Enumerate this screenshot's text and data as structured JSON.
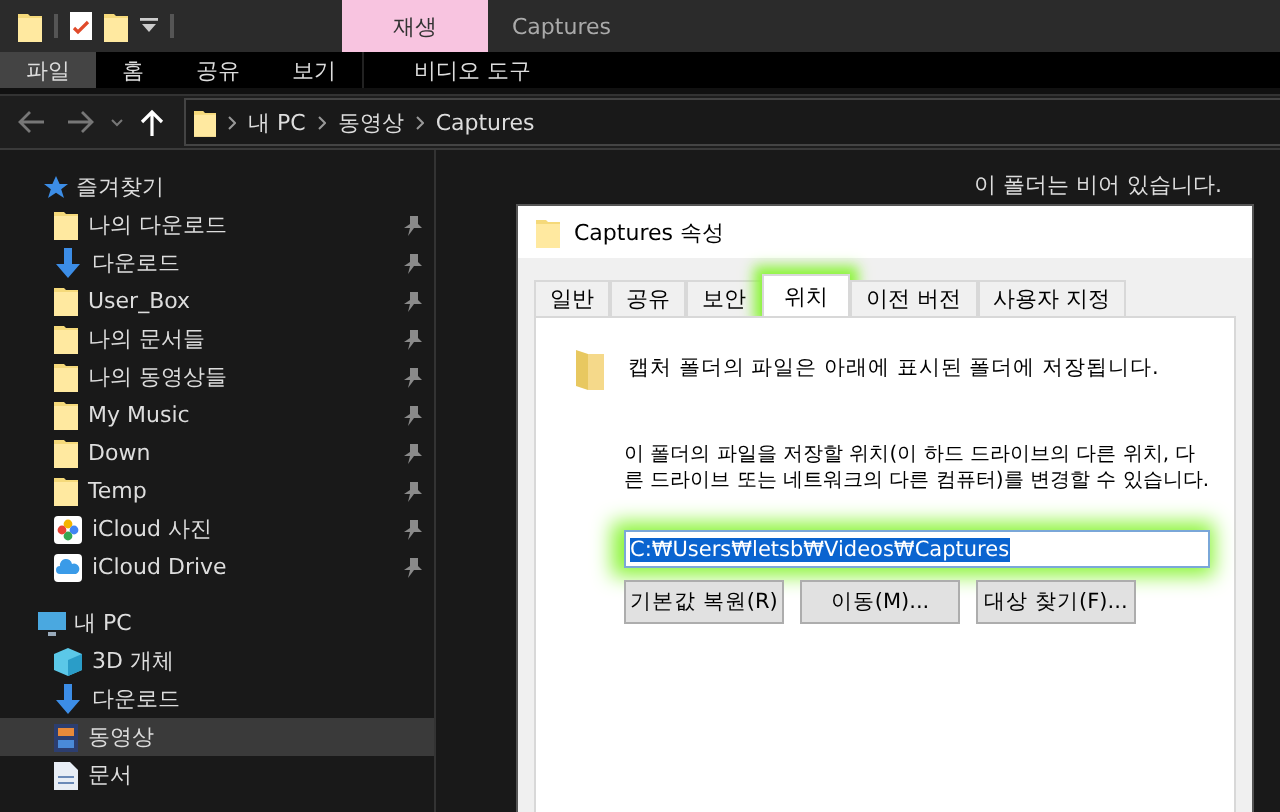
{
  "title_bar": {
    "contextual_tab": "재생",
    "title": "Captures"
  },
  "ribbon_tabs": [
    {
      "label": "파일",
      "selected": true
    },
    {
      "label": "홈",
      "selected": false
    },
    {
      "label": "공유",
      "selected": false
    },
    {
      "label": "보기",
      "selected": false
    },
    {
      "label": "비디오 도구",
      "selected": false
    }
  ],
  "address_bar": {
    "path": [
      "내 PC",
      "동영상",
      "Captures"
    ]
  },
  "sidebar": {
    "sections": [
      {
        "label": "즐겨찾기",
        "kind": "star",
        "children": [
          {
            "label": "나의 다운로드",
            "kind": "folder",
            "pinned": true,
            "selected": false
          },
          {
            "label": "다운로드",
            "kind": "download",
            "pinned": true,
            "selected": false
          },
          {
            "label": "User_Box",
            "kind": "folder",
            "pinned": true,
            "selected": false
          },
          {
            "label": "나의 문서들",
            "kind": "folder",
            "pinned": true,
            "selected": false
          },
          {
            "label": "나의 동영상들",
            "kind": "folder",
            "pinned": true,
            "selected": false
          },
          {
            "label": "My Music",
            "kind": "folder",
            "pinned": true,
            "selected": false
          },
          {
            "label": "Down",
            "kind": "folder",
            "pinned": true,
            "selected": false
          },
          {
            "label": "Temp",
            "kind": "folder",
            "pinned": true,
            "selected": false
          },
          {
            "label": "iCloud 사진",
            "kind": "photos",
            "pinned": true,
            "selected": false
          },
          {
            "label": "iCloud Drive",
            "kind": "cloud",
            "pinned": true,
            "selected": false
          }
        ]
      },
      {
        "label": "내 PC",
        "kind": "pc",
        "children": [
          {
            "label": "3D 개체",
            "kind": "cube",
            "pinned": false,
            "selected": false
          },
          {
            "label": "다운로드",
            "kind": "download",
            "pinned": false,
            "selected": false
          },
          {
            "label": "동영상",
            "kind": "video",
            "pinned": false,
            "selected": true
          },
          {
            "label": "문서",
            "kind": "document",
            "pinned": false,
            "selected": false
          }
        ]
      }
    ]
  },
  "empty_message": "이 폴더는 비어 있습니다.",
  "dialog": {
    "title": "Captures 속성",
    "tabs": [
      {
        "label": "일반",
        "selected": false,
        "highlighted": false
      },
      {
        "label": "공유",
        "selected": false,
        "highlighted": false
      },
      {
        "label": "보안",
        "selected": false,
        "highlighted": false
      },
      {
        "label": "위치",
        "selected": true,
        "highlighted": true
      },
      {
        "label": "이전 버전",
        "selected": false,
        "highlighted": false
      },
      {
        "label": "사용자 지정",
        "selected": false,
        "highlighted": false
      }
    ],
    "info": "캡처 폴더의 파일은 아래에 표시된 폴더에 저장됩니다.",
    "description": "이 폴더의 파일을 저장할 위치(이 하드 드라이브의 다른 위치, 다른 드라이브 또는 네트워크의 다른 컴퓨터)를 변경할 수 있습니다.",
    "path_field": {
      "value": "C:₩Users₩letsb₩Videos₩Captures",
      "text_selected": true,
      "highlighted": true
    },
    "buttons": [
      "기본값 복원(R)",
      "이동(M)...",
      "대상 찾기(F)..."
    ]
  }
}
